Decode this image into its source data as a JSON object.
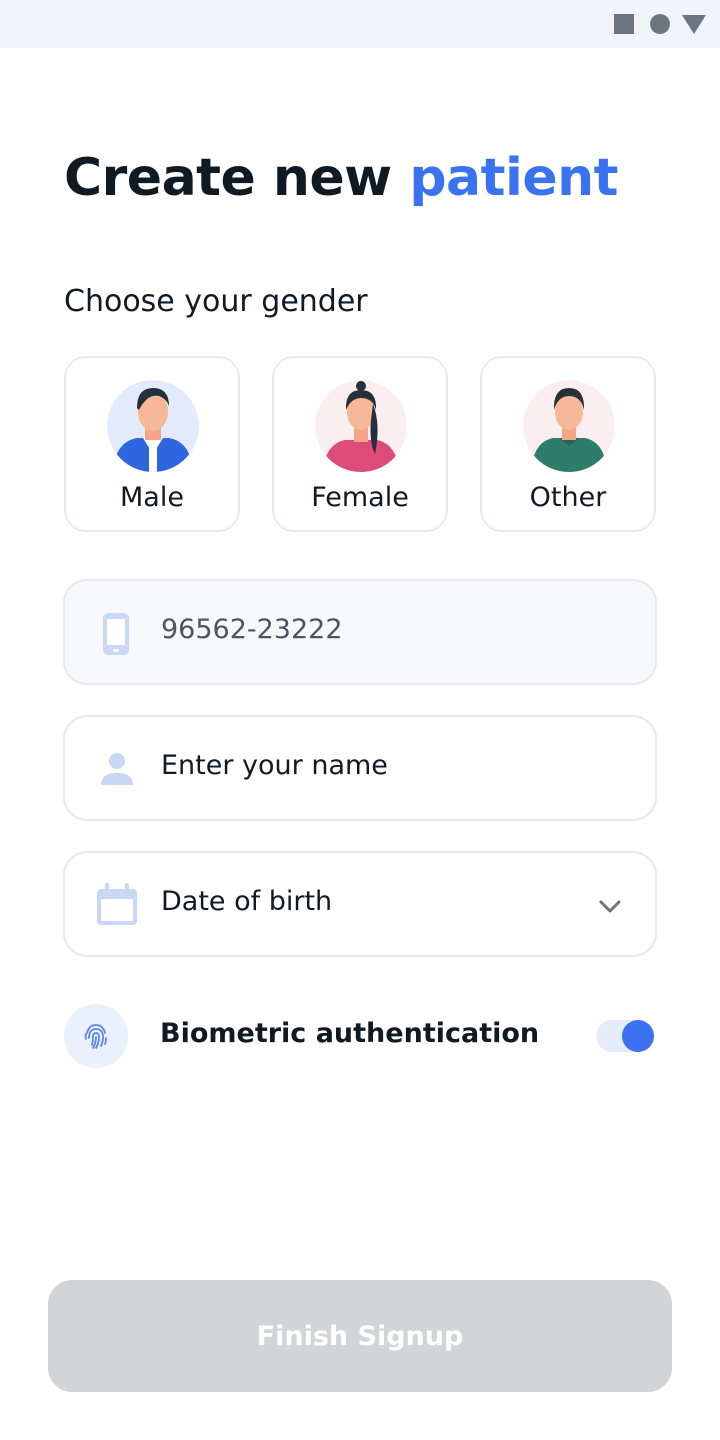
{
  "status_bar": {
    "icons": [
      "square-icon",
      "circle-icon",
      "triangle-icon"
    ],
    "color": "#6c7580"
  },
  "title": {
    "prefix": "Create new",
    "accent": "patient",
    "accent_color": "#3b72f2"
  },
  "gender": {
    "label": "Choose your gender",
    "options": [
      {
        "label": "Male",
        "avatar": "male-avatar-icon"
      },
      {
        "label": "Female",
        "avatar": "female-avatar-icon"
      },
      {
        "label": "Other",
        "avatar": "other-avatar-icon"
      }
    ]
  },
  "phone": {
    "value": "96562-23222",
    "icon": "phone-icon"
  },
  "name": {
    "placeholder": "Enter your name",
    "icon": "user-icon"
  },
  "dob": {
    "placeholder": "Date of birth",
    "icon": "calendar-icon"
  },
  "biometric": {
    "label": "Biometric authentication",
    "icon": "fingerprint-icon",
    "enabled": true
  },
  "finish_button": {
    "label": "Finish Signup",
    "disabled": true
  }
}
